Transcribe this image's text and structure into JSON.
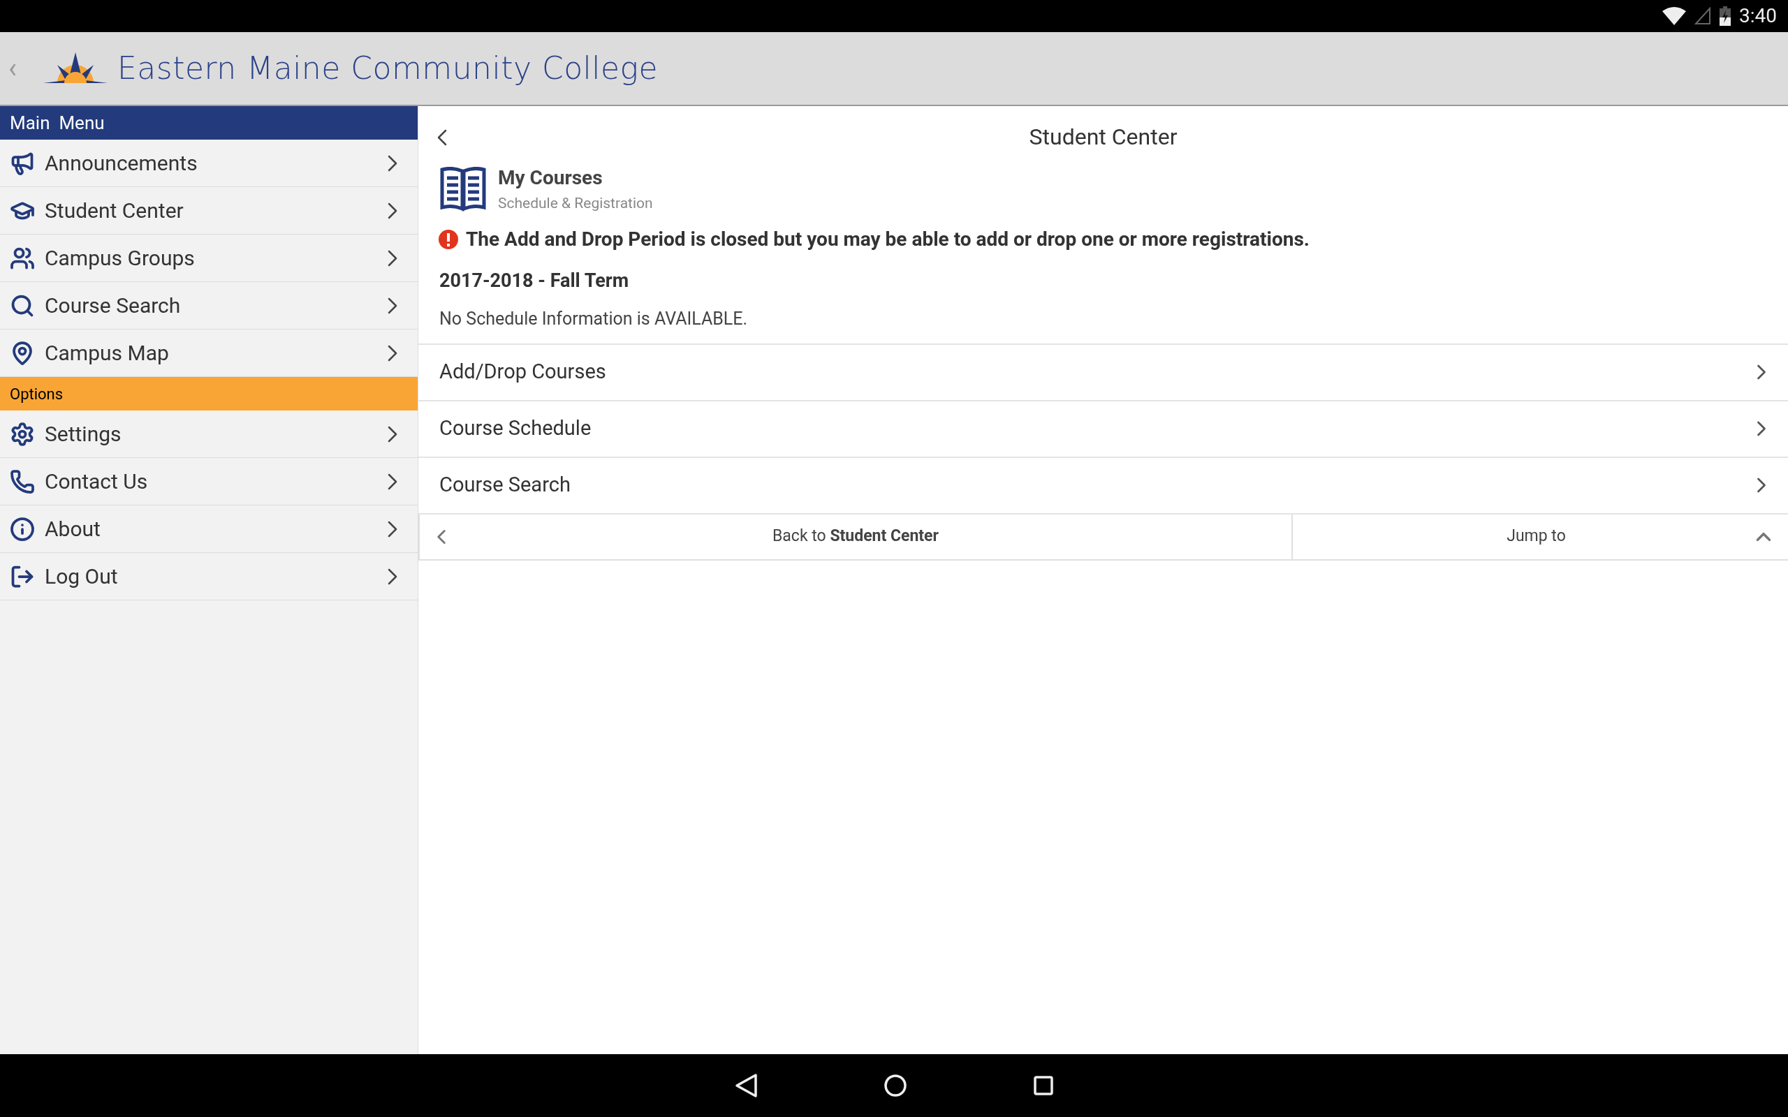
{
  "status_bar": {
    "time": "3:40"
  },
  "header": {
    "back": "‹",
    "title": "Eastern Maine Community College"
  },
  "sidebar": {
    "sections": [
      {
        "title": "Main  Menu",
        "color": "#233a7c",
        "items": [
          "Announcements",
          "Student Center",
          "Campus Groups",
          "Course Search",
          "Campus Map"
        ]
      },
      {
        "title": "Options",
        "color": "#f9a535",
        "items": [
          "Settings",
          "Contact Us",
          "About",
          "Log Out"
        ]
      }
    ]
  },
  "content": {
    "title": "Student Center",
    "card": {
      "title": "My Courses",
      "subtitle": "Schedule & Registration"
    },
    "alert": "The Add and Drop Period is closed but you may be able to add or drop one or more registrations.",
    "term": "2017-2018 - Fall Term",
    "message": "No Schedule Information is AVAILABLE.",
    "links": [
      "Add/Drop Courses",
      "Course Schedule",
      "Course Search"
    ],
    "footer": {
      "back": "Back to **Student Center**",
      "jump": "Jump to"
    }
  }
}
